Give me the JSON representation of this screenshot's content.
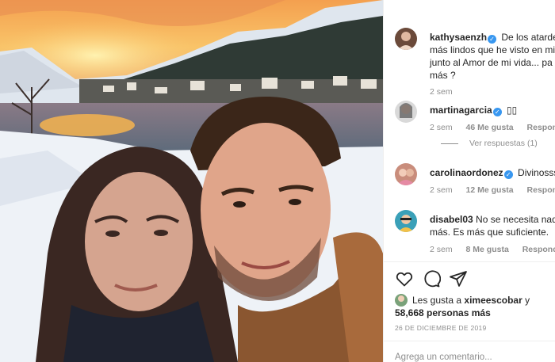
{
  "post": {
    "image_alt": "Selfie de pareja frente a un lago nevado al atardecer"
  },
  "comments": [
    {
      "username": "kathysaenzh",
      "verified": true,
      "lines": [
        "De los atardec",
        "más lindos que he visto en mi",
        "junto al Amor de mi vida... pa",
        "más ?"
      ],
      "time": "2 sem"
    },
    {
      "username": "martinagarcia",
      "verified": true,
      "text": "▯▯",
      "time": "2 sem",
      "likes": "46 Me gusta",
      "reply": "Responder",
      "view_replies": "Ver respuestas (1)"
    },
    {
      "username": "carolinaordonez",
      "verified": true,
      "text": "Divinosss",
      "time": "2 sem",
      "likes": "12 Me gusta",
      "reply": "Responder"
    },
    {
      "username": "disabel03",
      "verified": false,
      "lines": [
        "No se necesita nad",
        "más. Es más que suficiente."
      ],
      "time": "2 sem",
      "likes": "8 Me gusta",
      "reply": "Responder"
    }
  ],
  "likes": {
    "prefix": "Les gusta a",
    "user": "ximeescobar",
    "conj": "y",
    "count": "58,668 personas más"
  },
  "date": "26 DE DICIEMBRE DE 2019",
  "add_comment_placeholder": "Agrega un comentario...",
  "icons": [
    "heart-icon",
    "comment-icon",
    "share-icon"
  ],
  "colors": {
    "verified": "#3897f0",
    "muted": "#8e8e8e",
    "text": "#262626"
  }
}
